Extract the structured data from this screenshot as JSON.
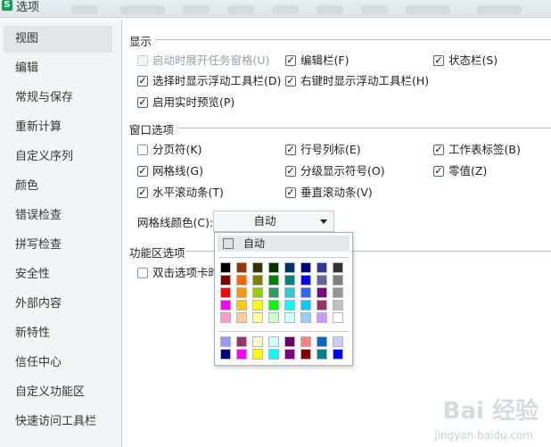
{
  "window": {
    "title": "选项",
    "logo_text": "S"
  },
  "sidebar": {
    "items": [
      {
        "label": "视图",
        "active": true
      },
      {
        "label": "编辑"
      },
      {
        "label": "常规与保存"
      },
      {
        "label": "重新计算"
      },
      {
        "label": "自定义序列"
      },
      {
        "label": "颜色"
      },
      {
        "label": "错误检查"
      },
      {
        "label": "拼写检查"
      },
      {
        "label": "安全性"
      },
      {
        "label": "外部内容"
      },
      {
        "label": "新特性"
      },
      {
        "label": "信任中心"
      },
      {
        "label": "自定义功能区"
      },
      {
        "label": "快速访问工具栏"
      }
    ]
  },
  "display": {
    "heading": "显示",
    "options": [
      {
        "label": "启动时展开任务窗格(U)",
        "checked": false,
        "disabled": true
      },
      {
        "label": "编辑栏(F)",
        "checked": true
      },
      {
        "label": "状态栏(S)",
        "checked": true
      },
      {
        "label": "选择时显示浮动工具栏(D)",
        "checked": true
      },
      {
        "label": "右键时显示浮动工具栏(H)",
        "checked": true
      },
      {
        "label": "启用实时预览(P)",
        "checked": true
      }
    ]
  },
  "window_options": {
    "heading": "窗口选项",
    "options": [
      {
        "label": "分页符(K)",
        "checked": false
      },
      {
        "label": "行号列标(E)",
        "checked": true
      },
      {
        "label": "工作表标签(B)",
        "checked": true
      },
      {
        "label": "网格线(G)",
        "checked": true
      },
      {
        "label": "分级显示符号(O)",
        "checked": true
      },
      {
        "label": "零值(Z)",
        "checked": true
      },
      {
        "label": "水平滚动条(T)",
        "checked": true
      },
      {
        "label": "垂直滚动条(V)",
        "checked": true
      }
    ],
    "grid_color_label": "网格线颜色(C):",
    "grid_color_value": "自动"
  },
  "ribbon": {
    "heading": "功能区选项",
    "double_click_label": "双击选项卡时",
    "double_click_checked": false
  },
  "color_popup": {
    "auto_label": "自动",
    "grid_rows": [
      [
        "#000000",
        "#993300",
        "#333300",
        "#003300",
        "#003366",
        "#000080",
        "#333399",
        "#333333"
      ],
      [
        "#800000",
        "#FF6600",
        "#808000",
        "#008000",
        "#008080",
        "#0000FF",
        "#666699",
        "#808080"
      ],
      [
        "#FF0000",
        "#FF9900",
        "#99CC00",
        "#339966",
        "#33CCCC",
        "#3366FF",
        "#800080",
        "#969696"
      ],
      [
        "#FF00FF",
        "#FFCC00",
        "#FFFF00",
        "#00FF00",
        "#00FFFF",
        "#00CCFF",
        "#993366",
        "#C0C0C0"
      ],
      [
        "#FF99CC",
        "#FFCC99",
        "#FFFF99",
        "#CCFFCC",
        "#CCFFFF",
        "#99CCFF",
        "#CC99FF",
        "#FFFFFF"
      ]
    ],
    "extra_rows": [
      [
        "#9999FF",
        "#993366",
        "#FFFFCC",
        "#CCFFFF",
        "#660066",
        "#FF8080",
        "#0066CC",
        "#CCCCFF"
      ],
      [
        "#000080",
        "#FF00FF",
        "#FFFF00",
        "#00FFFF",
        "#800080",
        "#800000",
        "#008080",
        "#0000FF"
      ]
    ]
  },
  "watermark": {
    "brand": "Bai 经验",
    "sub": "jingyan.baidu.com"
  }
}
